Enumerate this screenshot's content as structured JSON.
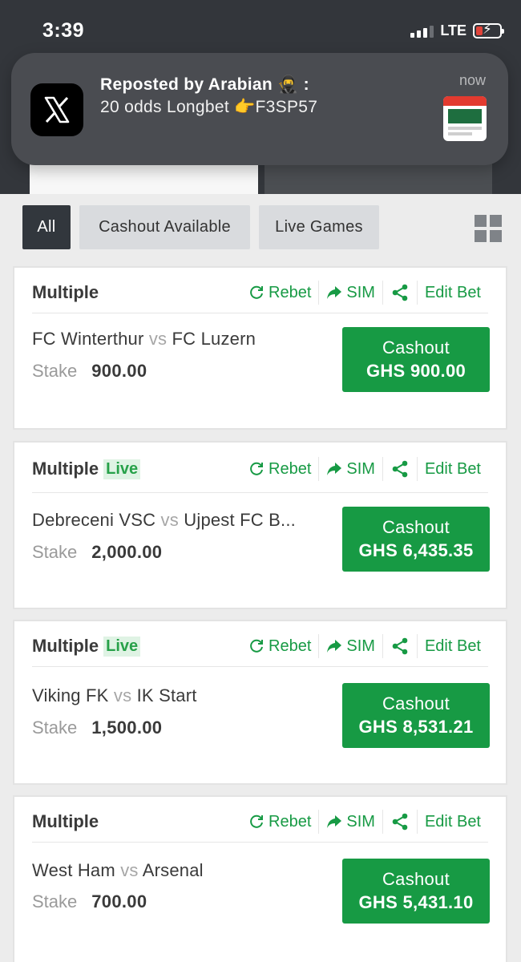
{
  "status_bar": {
    "time": "3:39",
    "network": "LTE",
    "icons": [
      "signal-icon",
      "battery-charging-icon"
    ]
  },
  "notification": {
    "app_icon": "x-logo-icon",
    "title": "Reposted by Arabian 🥷 :",
    "body": "20 odds Longbet 👉F3SP57",
    "time": "now"
  },
  "filters": {
    "items": [
      {
        "label": "All",
        "active": true
      },
      {
        "label": "Cashout Available",
        "active": false
      },
      {
        "label": "Live Games",
        "active": false
      }
    ],
    "layout_icon": "grid-view-icon"
  },
  "actions": {
    "rebet": "Rebet",
    "sim": "SIM",
    "edit": "Edit Bet"
  },
  "bets": [
    {
      "type": "Multiple",
      "live": "",
      "home": "FC Winterthur",
      "vs": "vs",
      "away": "FC Luzern",
      "stake_label": "Stake",
      "stake": "900.00",
      "cashout_label": "Cashout",
      "cashout_amount": "GHS 900.00"
    },
    {
      "type": "Multiple",
      "live": "Live",
      "home": "Debreceni VSC",
      "vs": "vs",
      "away": "Ujpest FC B...",
      "stake_label": "Stake",
      "stake": "2,000.00",
      "cashout_label": "Cashout",
      "cashout_amount": "GHS 6,435.35"
    },
    {
      "type": "Multiple",
      "live": "Live",
      "home": "Viking FK",
      "vs": "vs",
      "away": "IK Start",
      "stake_label": "Stake",
      "stake": "1,500.00",
      "cashout_label": "Cashout",
      "cashout_amount": "GHS 8,531.21"
    },
    {
      "type": "Multiple",
      "live": "",
      "home": "West Ham",
      "vs": "vs",
      "away": "Arsenal",
      "stake_label": "Stake",
      "stake": "700.00",
      "cashout_label": "Cashout",
      "cashout_amount": "GHS 5,431.10"
    }
  ],
  "colors": {
    "accent_green": "#179a44",
    "dark_header": "#33363b",
    "chip_active": "#32373d"
  }
}
